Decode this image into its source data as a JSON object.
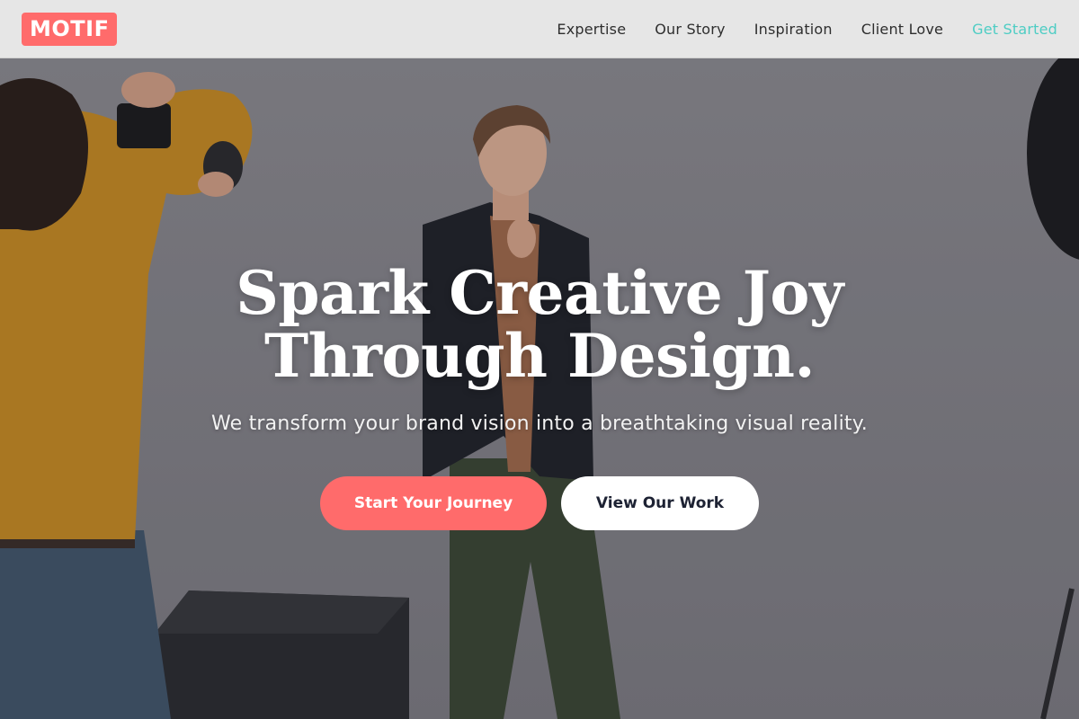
{
  "brand": {
    "logo": "MOTIF",
    "accent": "#ff6b6b",
    "highlight": "#4ecdc4"
  },
  "nav": {
    "items": [
      {
        "label": "Expertise"
      },
      {
        "label": "Our Story"
      },
      {
        "label": "Inspiration"
      },
      {
        "label": "Client Love"
      }
    ],
    "cta_label": "Get Started"
  },
  "hero": {
    "headline_line1": "Spark Creative Joy",
    "headline_line2": "Through Design.",
    "subtitle": "We transform your brand vision into a breathtaking visual reality.",
    "primary_button": "Start Your Journey",
    "secondary_button": "View Our Work"
  }
}
